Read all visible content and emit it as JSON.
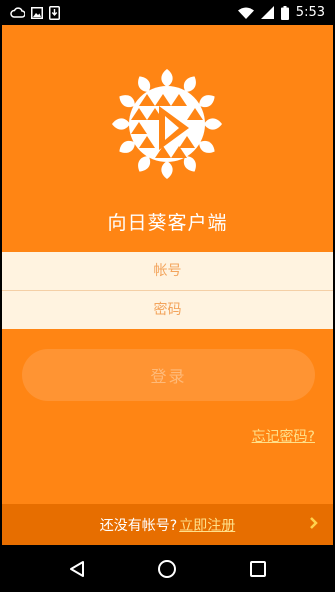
{
  "status_bar": {
    "time": "5:53",
    "left_icons": [
      "cloud-icon",
      "image-icon",
      "download-icon"
    ],
    "right_icons": [
      "wifi-icon",
      "signal-icon",
      "battery-icon"
    ]
  },
  "app": {
    "title": "向日葵客户端",
    "logo_icon": "sunflower-play-logo-icon"
  },
  "form": {
    "username_placeholder": "帐号",
    "password_placeholder": "密码",
    "login_label": "登录",
    "forgot_label": "忘记密码?"
  },
  "register": {
    "prompt": "还没有帐号?",
    "link": "立即注册"
  },
  "colors": {
    "primary": "#ff8514",
    "field_bg": "#fff3e0",
    "link": "#ffe08a",
    "bottom_bar": "#e76e00"
  }
}
